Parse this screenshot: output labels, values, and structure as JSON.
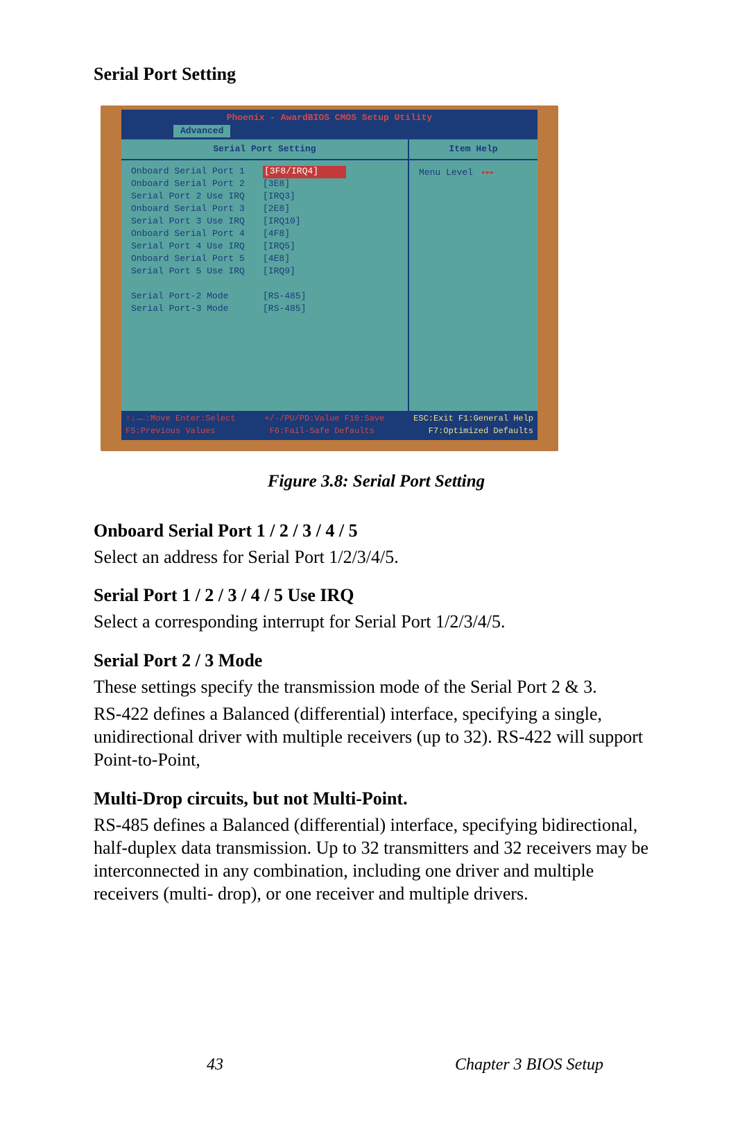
{
  "header": {
    "title": "Serial Port Setting"
  },
  "bios": {
    "title": "Phoenix - AwardBIOS CMOS Setup Utility",
    "tab": "Advanced",
    "left_pane_title": "Serial Port Setting",
    "right_pane_title": "Item Help",
    "menu_level_label": "Menu Level",
    "menu_level_arrows": "▸▸▸",
    "rows": [
      {
        "label": "Onboard Serial Port 1",
        "value": "[3F8/IRQ4]",
        "selected": true
      },
      {
        "label": "Onboard Serial Port 2",
        "value": "[3E8]"
      },
      {
        "label": "Serial Port 2 Use IRQ",
        "value": "[IRQ3]"
      },
      {
        "label": "Onboard Serial Port 3",
        "value": "[2E8]"
      },
      {
        "label": "Serial Port 3 Use IRQ",
        "value": "[IRQ10]"
      },
      {
        "label": "Onboard Serial Port 4",
        "value": "[4F8]"
      },
      {
        "label": "Serial Port 4 Use IRQ",
        "value": "[IRQ5]"
      },
      {
        "label": "Onboard Serial Port 5",
        "value": "[4E8]"
      },
      {
        "label": "Serial Port 5 Use IRQ",
        "value": "[IRQ9]"
      }
    ],
    "rows2": [
      {
        "label": "Serial Port-2 Mode",
        "value": "[RS-485]"
      },
      {
        "label": "Serial Port-3 Mode",
        "value": "[RS-485]"
      }
    ],
    "footer": {
      "l1a": "↑↓→←:Move  Enter:Select",
      "l1b": "+/-/PU/PD:Value  F10:Save",
      "l1c": "ESC:Exit  F1:General Help",
      "l2a": "F5:Previous Values",
      "l2b": "F6:Fail-Safe Defaults",
      "l2c": "F7:Optimized Defaults"
    }
  },
  "caption": "Figure 3.8: Serial Port Setting",
  "sections": {
    "s1_head": "Onboard Serial Port 1 / 2 / 3 / 4 / 5",
    "s1_body": "Select an address for Serial Port 1/2/3/4/5.",
    "s2_head": "Serial Port 1 / 2 / 3 / 4 / 5 Use IRQ",
    "s2_body": "Select a corresponding interrupt for Serial Port 1/2/3/4/5.",
    "s3_head": "Serial Port 2 / 3 Mode",
    "s3_body1": "These settings specify the transmission mode of the Serial Port 2 & 3.",
    "s3_body2": "RS-422 defines a Balanced (differential) interface, specifying a single, unidirectional driver with multiple receivers (up to 32). RS-422 will support Point-to-Point,",
    "s4_head": "Multi-Drop circuits, but not Multi-Point.",
    "s4_body": "RS-485 defines a Balanced (differential) interface, specifying bidirectional, half-duplex data transmission. Up to 32 transmitters and 32 receivers may be interconnected in any combination, including one driver and multiple receivers (multi- drop), or one receiver and multiple drivers."
  },
  "footer": {
    "page": "43",
    "chapter": "Chapter 3  BIOS Setup"
  }
}
